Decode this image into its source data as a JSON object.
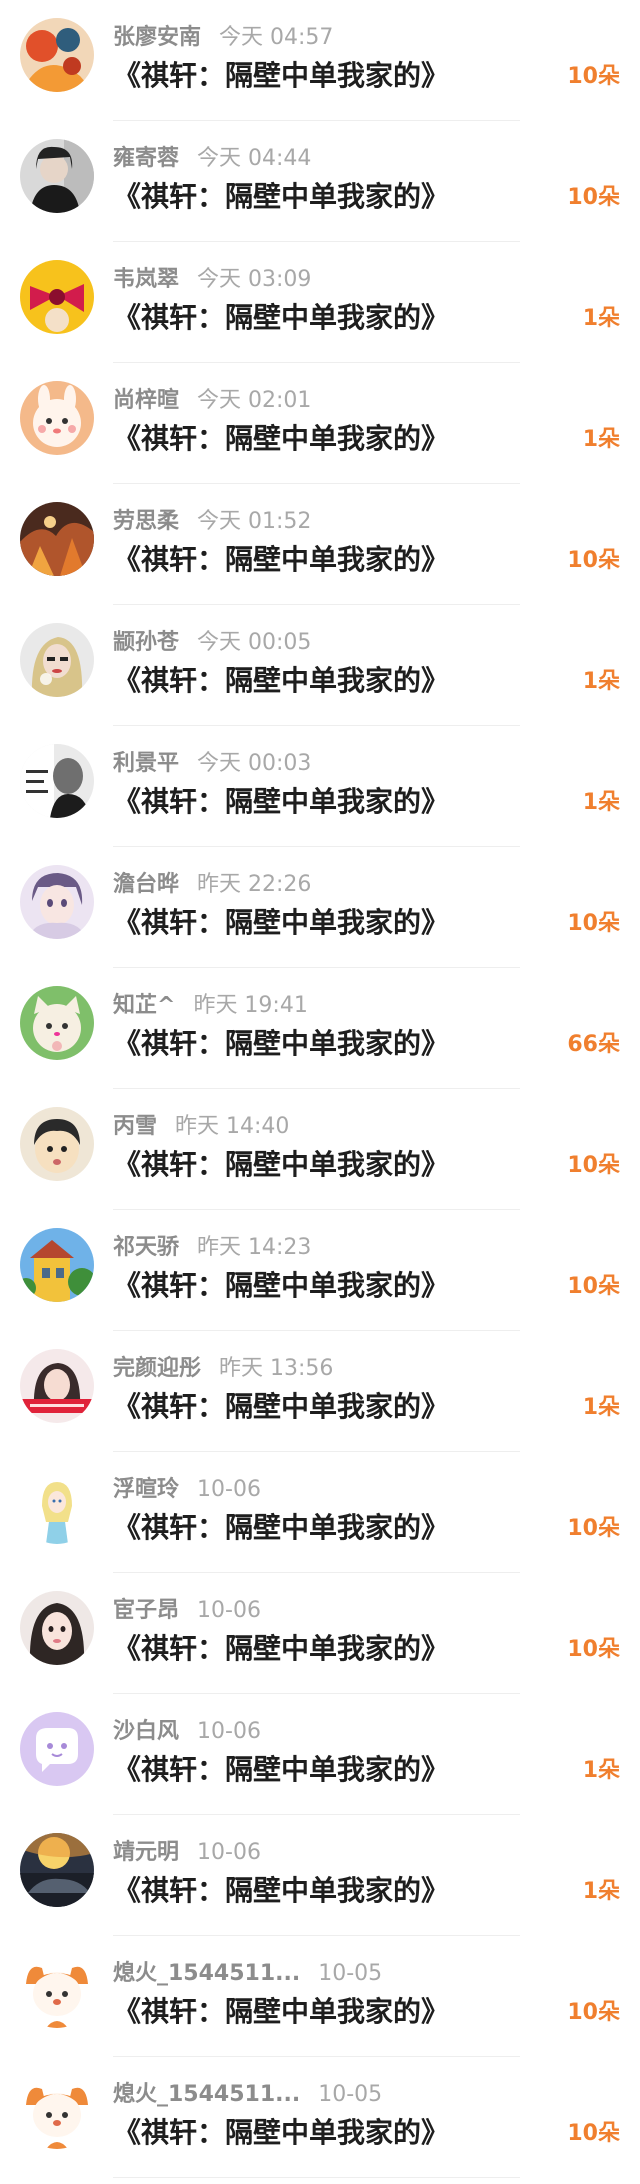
{
  "records": [
    {
      "name": "张廖安南",
      "time": "今天 04:57",
      "title": "《祺轩：隔壁中单我家的》",
      "flowers": "10朵",
      "avatar": "orange-abstract-avatar"
    },
    {
      "name": "雍寄蓉",
      "time": "今天 04:44",
      "title": "《祺轩：隔壁中单我家的》",
      "flowers": "10朵",
      "avatar": "dark-girl-avatar"
    },
    {
      "name": "韦岚翠",
      "time": "今天 03:09",
      "title": "《祺轩：隔壁中单我家的》",
      "flowers": "1朵",
      "avatar": "pink-bow-avatar"
    },
    {
      "name": "尚梓暄",
      "time": "今天 02:01",
      "title": "《祺轩：隔壁中单我家的》",
      "flowers": "1朵",
      "avatar": "cute-bunny-avatar"
    },
    {
      "name": "劳思柔",
      "time": "今天 01:52",
      "title": "《祺轩：隔壁中单我家的》",
      "flowers": "10朵",
      "avatar": "fire-scene-avatar"
    },
    {
      "name": "颛孙苍",
      "time": "今天 00:05",
      "title": "《祺轩：隔壁中单我家的》",
      "flowers": "1朵",
      "avatar": "blonde-girl-avatar"
    },
    {
      "name": "利景平",
      "time": "今天 00:03",
      "title": "《祺轩：隔壁中单我家的》",
      "flowers": "1朵",
      "avatar": "bw-man-avatar"
    },
    {
      "name": "澹台晔",
      "time": "昨天 22:26",
      "title": "《祺轩：隔壁中单我家的》",
      "flowers": "10朵",
      "avatar": "anime-boy-avatar"
    },
    {
      "name": "知芷^",
      "time": "昨天 19:41",
      "title": "《祺轩：隔壁中单我家的》",
      "flowers": "66朵",
      "avatar": "cat-green-avatar"
    },
    {
      "name": "丙雪",
      "time": "昨天 14:40",
      "title": "《祺轩：隔壁中单我家的》",
      "flowers": "10朵",
      "avatar": "cartoon-kid-avatar"
    },
    {
      "name": "祁天骄",
      "time": "昨天 14:23",
      "title": "《祺轩：隔壁中单我家的》",
      "flowers": "10朵",
      "avatar": "yellow-house-avatar"
    },
    {
      "name": "完颜迎彤",
      "time": "昨天 13:56",
      "title": "《祺轩：隔壁中单我家的》",
      "flowers": "1朵",
      "avatar": "red-banner-girl-avatar"
    },
    {
      "name": "浮暄玲",
      "time": "10-06",
      "title": "《祺轩：隔壁中单我家的》",
      "flowers": "10朵",
      "avatar": "princess-avatar"
    },
    {
      "name": "宦子昂",
      "time": "10-06",
      "title": "《祺轩：隔壁中单我家的》",
      "flowers": "10朵",
      "avatar": "girl-portrait-avatar"
    },
    {
      "name": "沙白风",
      "time": "10-06",
      "title": "《祺轩：隔壁中单我家的》",
      "flowers": "1朵",
      "avatar": "purple-chat-avatar"
    },
    {
      "name": "靖元明",
      "time": "10-06",
      "title": "《祺轩：隔壁中单我家的》",
      "flowers": "1朵",
      "avatar": "sunset-car-avatar"
    },
    {
      "name": "熄火_1544511...",
      "time": "10-05",
      "title": "《祺轩：隔壁中单我家的》",
      "flowers": "10朵",
      "avatar": "orange-dog-avatar"
    },
    {
      "name": "熄火_1544511...",
      "time": "10-05",
      "title": "《祺轩：隔壁中单我家的》",
      "flowers": "10朵",
      "avatar": "orange-dog-avatar"
    }
  ],
  "colors": {
    "accent": "#f07f2e",
    "name_gray": "#8c8c8c",
    "title_black": "#1e1e1e",
    "divider": "#eeeeee"
  }
}
